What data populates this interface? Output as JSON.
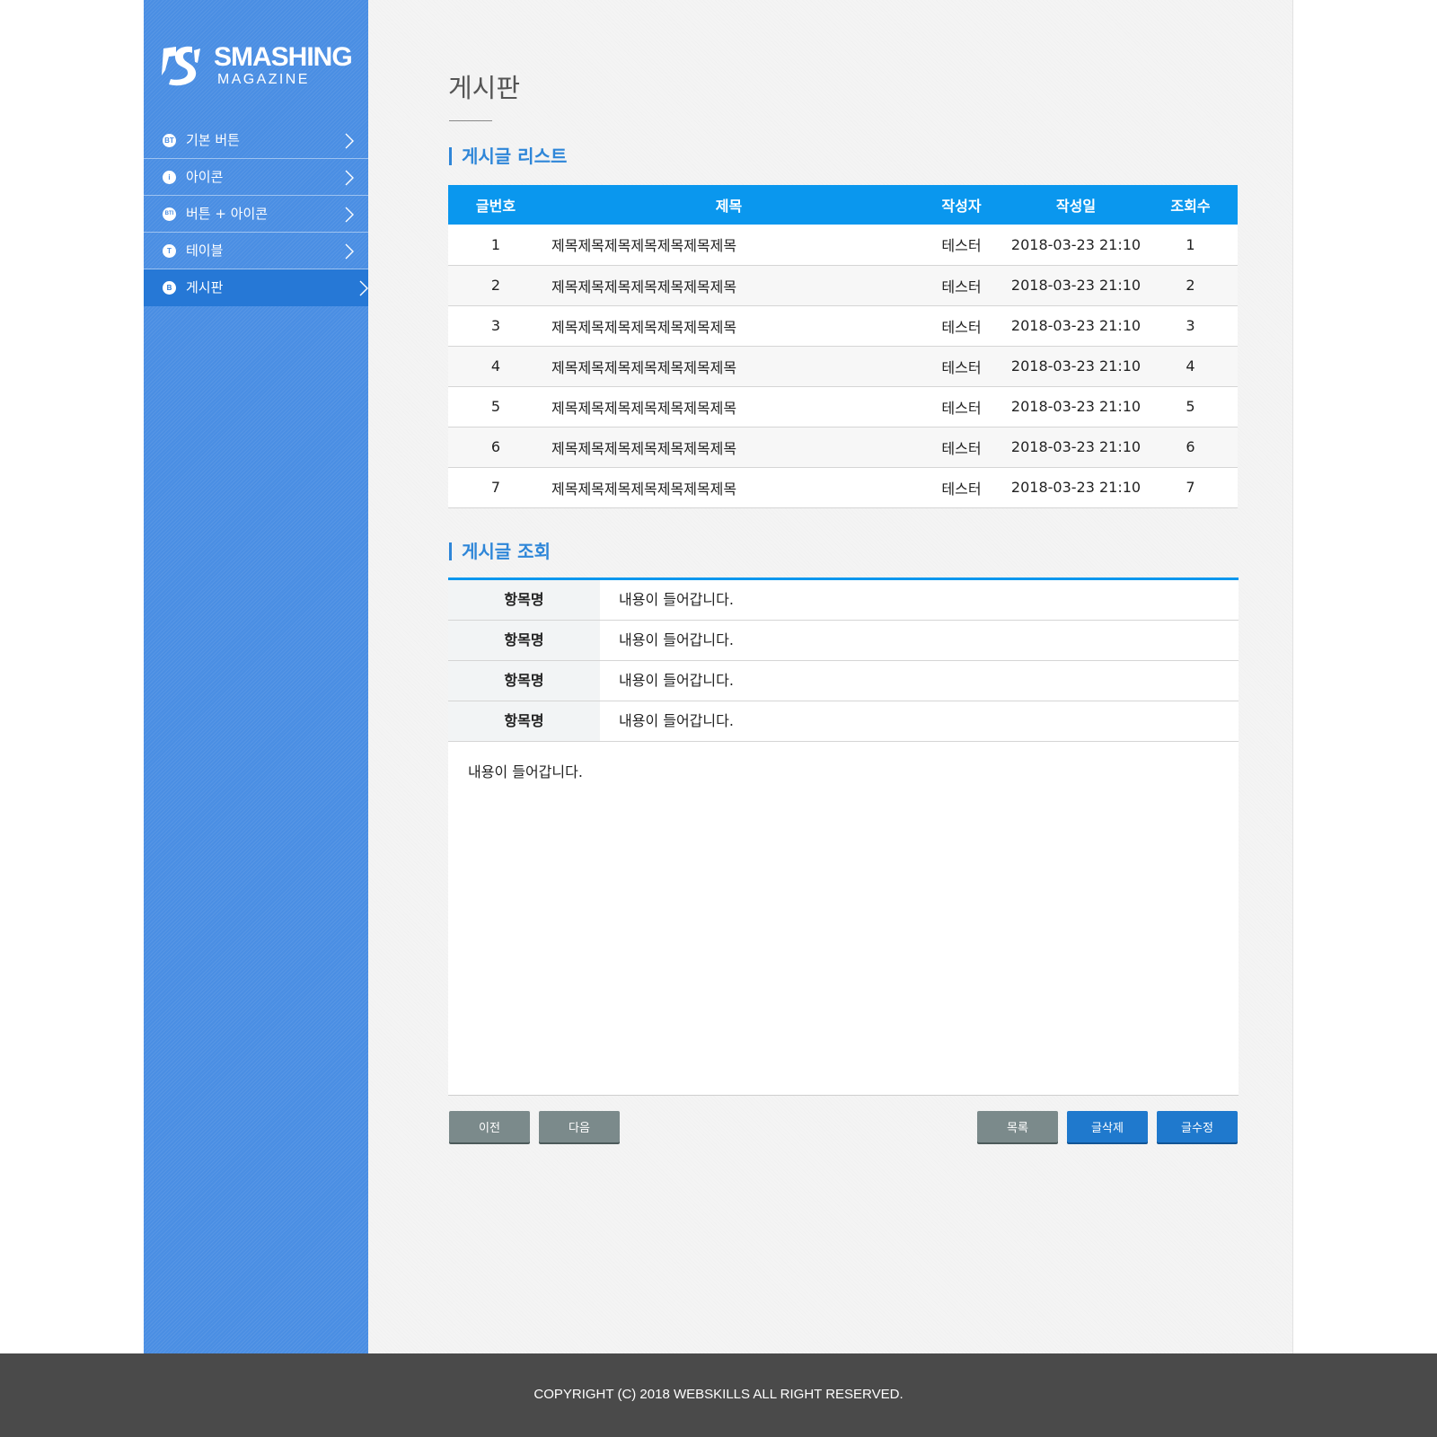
{
  "brand": {
    "title": "SMASHING",
    "subtitle": "MAGAZINE"
  },
  "sidebar": {
    "items": [
      {
        "label": "기본 버튼",
        "icon_text": "BT",
        "icon": "bt-circle-icon",
        "active": false
      },
      {
        "label": "아이콘",
        "icon_text": "i",
        "icon": "info-circle-icon",
        "active": false
      },
      {
        "label": "버튼 + 아이콘",
        "icon_text": "BTI",
        "icon": "bti-circle-icon",
        "active": false
      },
      {
        "label": "테이블",
        "icon_text": "T",
        "icon": "t-circle-icon",
        "active": false
      },
      {
        "label": "게시판",
        "icon_text": "B",
        "icon": "b-circle-icon",
        "active": true
      }
    ]
  },
  "page": {
    "title": "게시판"
  },
  "list_section": {
    "title": "게시글 리스트",
    "columns": [
      "글번호",
      "제목",
      "작성자",
      "작성일",
      "조회수"
    ],
    "rows": [
      {
        "no": "1",
        "title": "제목제목제목제목제목제목제목",
        "author": "테스터",
        "date": "2018-03-23 21:10",
        "views": "1"
      },
      {
        "no": "2",
        "title": "제목제목제목제목제목제목제목",
        "author": "테스터",
        "date": "2018-03-23 21:10",
        "views": "2"
      },
      {
        "no": "3",
        "title": "제목제목제목제목제목제목제목",
        "author": "테스터",
        "date": "2018-03-23 21:10",
        "views": "3"
      },
      {
        "no": "4",
        "title": "제목제목제목제목제목제목제목",
        "author": "테스터",
        "date": "2018-03-23 21:10",
        "views": "4"
      },
      {
        "no": "5",
        "title": "제목제목제목제목제목제목제목",
        "author": "테스터",
        "date": "2018-03-23 21:10",
        "views": "5"
      },
      {
        "no": "6",
        "title": "제목제목제목제목제목제목제목",
        "author": "테스터",
        "date": "2018-03-23 21:10",
        "views": "6"
      },
      {
        "no": "7",
        "title": "제목제목제목제목제목제목제목",
        "author": "테스터",
        "date": "2018-03-23 21:10",
        "views": "7"
      }
    ]
  },
  "detail_section": {
    "title": "게시글 조회",
    "fields": [
      {
        "key": "항목명",
        "value": "내용이 들어갑니다."
      },
      {
        "key": "항목명",
        "value": "내용이 들어갑니다."
      },
      {
        "key": "항목명",
        "value": "내용이 들어갑니다."
      },
      {
        "key": "항목명",
        "value": "내용이 들어갑니다."
      }
    ],
    "body": "내용이 들어갑니다."
  },
  "buttons": {
    "prev": "이전",
    "next": "다음",
    "list": "목록",
    "delete": "글삭제",
    "edit": "글수정"
  },
  "colors": {
    "sidebar": "#4a8ee3",
    "sidebar_active": "#2678d6",
    "table_header": "#0a97ee",
    "accent_text": "#2e86d8",
    "button_gray": "#7b8a8b",
    "button_blue": "#1f79cd",
    "footer": "#4a4a4a"
  },
  "footer": {
    "copyright": "COPYRIGHT (C) 2018 WEBSKILLS ALL RIGHT RESERVED."
  }
}
